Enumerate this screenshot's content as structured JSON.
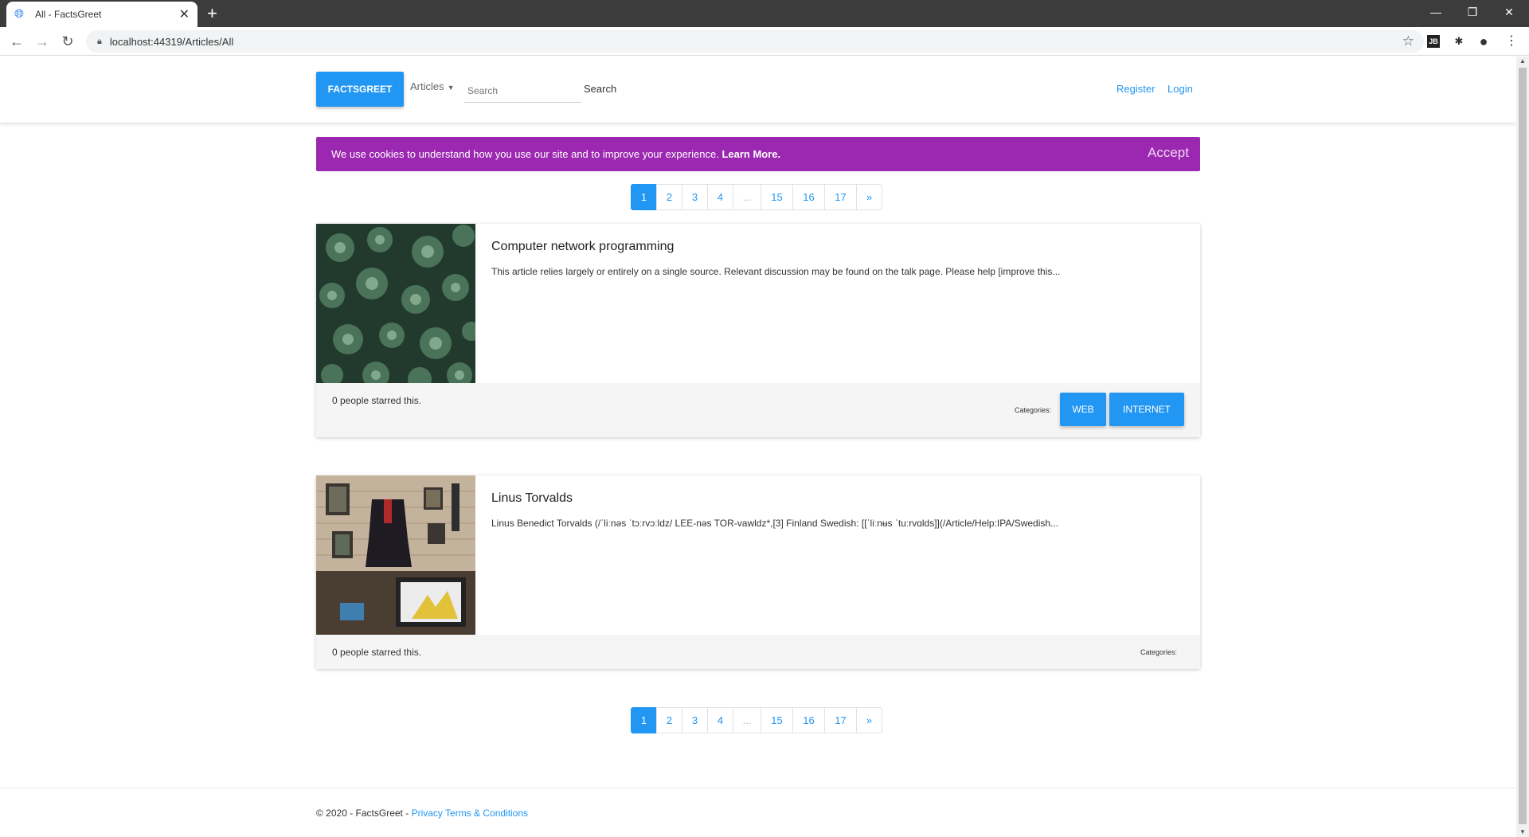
{
  "browser": {
    "tab_title": "All - FactsGreet",
    "url": "localhost:44319/Articles/All"
  },
  "header": {
    "brand": "FACTSGREET",
    "articles_label": "Articles",
    "search_placeholder": "Search",
    "search_button": "Search",
    "register": "Register",
    "login": "Login"
  },
  "cookie": {
    "message": "We use cookies to understand how you use our site and to improve your experience.",
    "learn_more": "Learn More.",
    "accept": "Accept"
  },
  "pagination": {
    "pages": [
      "1",
      "2",
      "3",
      "4",
      "...",
      "15",
      "16",
      "17",
      "»"
    ],
    "active": "1"
  },
  "articles": [
    {
      "title": "Computer network programming",
      "excerpt": "This article relies largely or entirely on a single source. Relevant discussion may be found on the talk page. Please help [improve this...",
      "stars": "0 people starred this.",
      "categories_label": "Categories:",
      "categories": [
        "WEB",
        "INTERNET"
      ]
    },
    {
      "title": "Linus Torvalds",
      "excerpt": "Linus Benedict Torvalds (/ˈliːnəs ˈtɔːrvɔːldz/ LEE-nəs TOR-vawldz*,[3] Finland Swedish: [[ˈliːnʉs ˈtuːrvɑlds]](/Article/Help:IPA/Swedish...",
      "stars": "0 people starred this.",
      "categories_label": "Categories:",
      "categories": []
    }
  ],
  "footer": {
    "copyright": "© 2020 - FactsGreet - ",
    "privacy_link": "Privacy Terms & Conditions"
  },
  "colors": {
    "primary": "#2196f3",
    "cookie_bg": "#9c27b0"
  }
}
